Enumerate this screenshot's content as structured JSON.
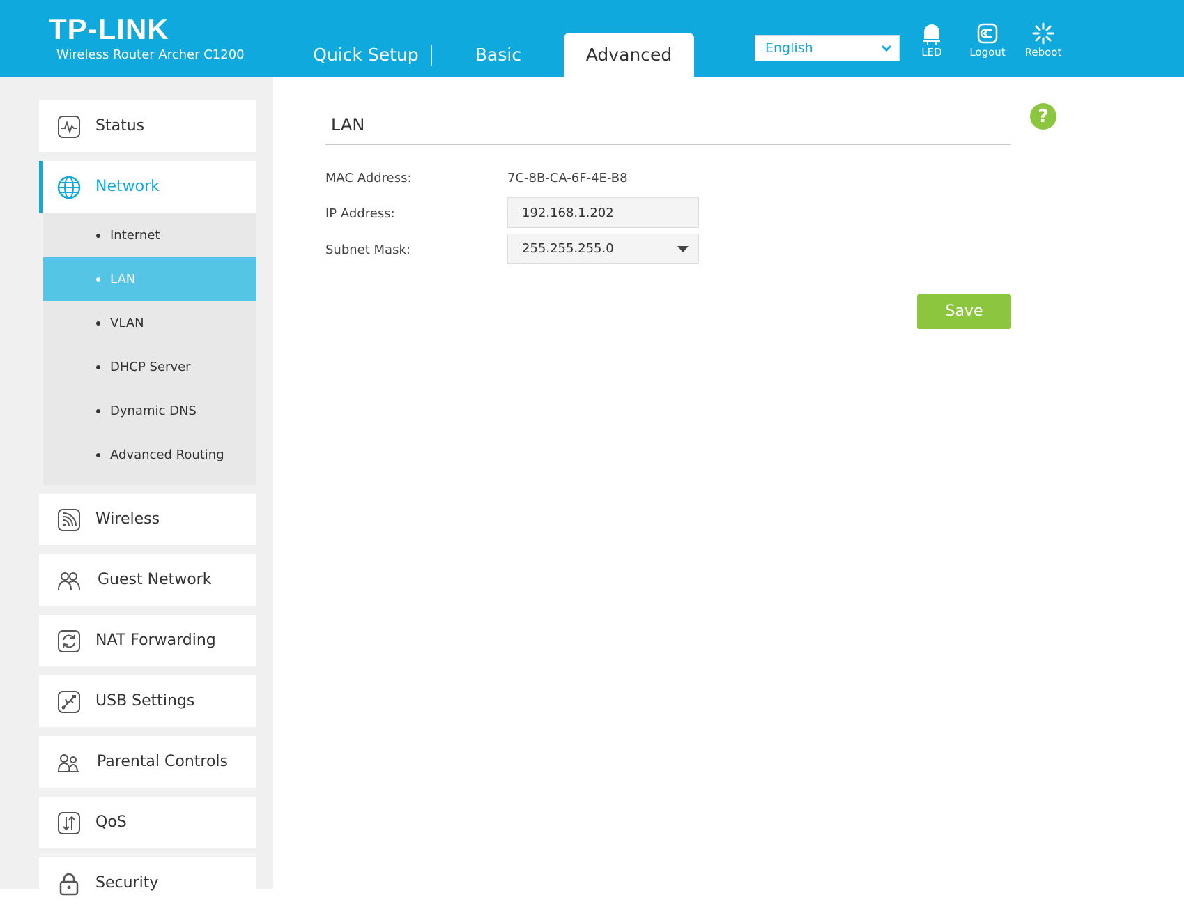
{
  "header": {
    "logo": "TP-LINK",
    "model": "Wireless Router Archer C1200",
    "tabs": [
      {
        "label": "Quick Setup"
      },
      {
        "label": "Basic"
      },
      {
        "label": "Advanced"
      }
    ],
    "language": "English",
    "buttons": {
      "led": "LED",
      "logout": "Logout",
      "reboot": "Reboot"
    }
  },
  "sidebar": {
    "items": [
      {
        "label": "Status",
        "icon": "status-icon"
      },
      {
        "label": "Network",
        "icon": "globe-icon",
        "active": true
      },
      {
        "label": "Wireless",
        "icon": "wireless-icon"
      },
      {
        "label": "Guest Network",
        "icon": "guest-network-icon"
      },
      {
        "label": "NAT Forwarding",
        "icon": "nat-forwarding-icon"
      },
      {
        "label": "USB Settings",
        "icon": "usb-icon"
      },
      {
        "label": "Parental Controls",
        "icon": "parental-controls-icon"
      },
      {
        "label": "QoS",
        "icon": "qos-icon"
      },
      {
        "label": "Security",
        "icon": "lock-icon"
      }
    ],
    "network_submenu": [
      {
        "label": "Internet"
      },
      {
        "label": "LAN",
        "active": true
      },
      {
        "label": "VLAN"
      },
      {
        "label": "DHCP Server"
      },
      {
        "label": "Dynamic DNS"
      },
      {
        "label": "Advanced Routing"
      }
    ]
  },
  "main": {
    "title": "LAN",
    "mac_label": "MAC Address:",
    "mac_value": "7C-8B-CA-6F-4E-B8",
    "ip_label": "IP Address:",
    "ip_value": "192.168.1.202",
    "subnet_label": "Subnet Mask:",
    "subnet_value": "255.255.255.0",
    "save_label": "Save",
    "help_label": "?"
  },
  "colors": {
    "brand": "#10a9de",
    "active_submenu": "#55c5e6",
    "save": "#8cc63f"
  }
}
